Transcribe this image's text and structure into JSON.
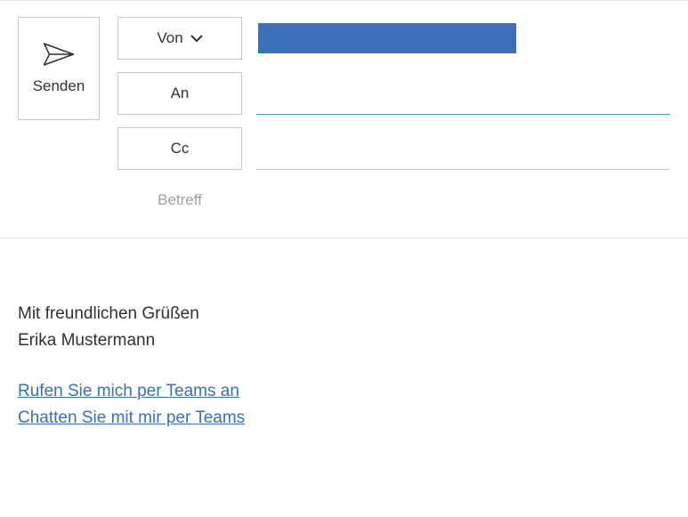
{
  "send": {
    "label": "Senden"
  },
  "fields": {
    "from": {
      "label": "Von"
    },
    "to": {
      "label": "An"
    },
    "cc": {
      "label": "Cc"
    },
    "subject": {
      "label": "Betreff"
    }
  },
  "body": {
    "closing": "Mit freundlichen Grüßen",
    "name": "Erika Mustermann",
    "links": {
      "call": "Rufen Sie mich per Teams an",
      "chat": "Chatten Sie mit mir per Teams"
    }
  }
}
